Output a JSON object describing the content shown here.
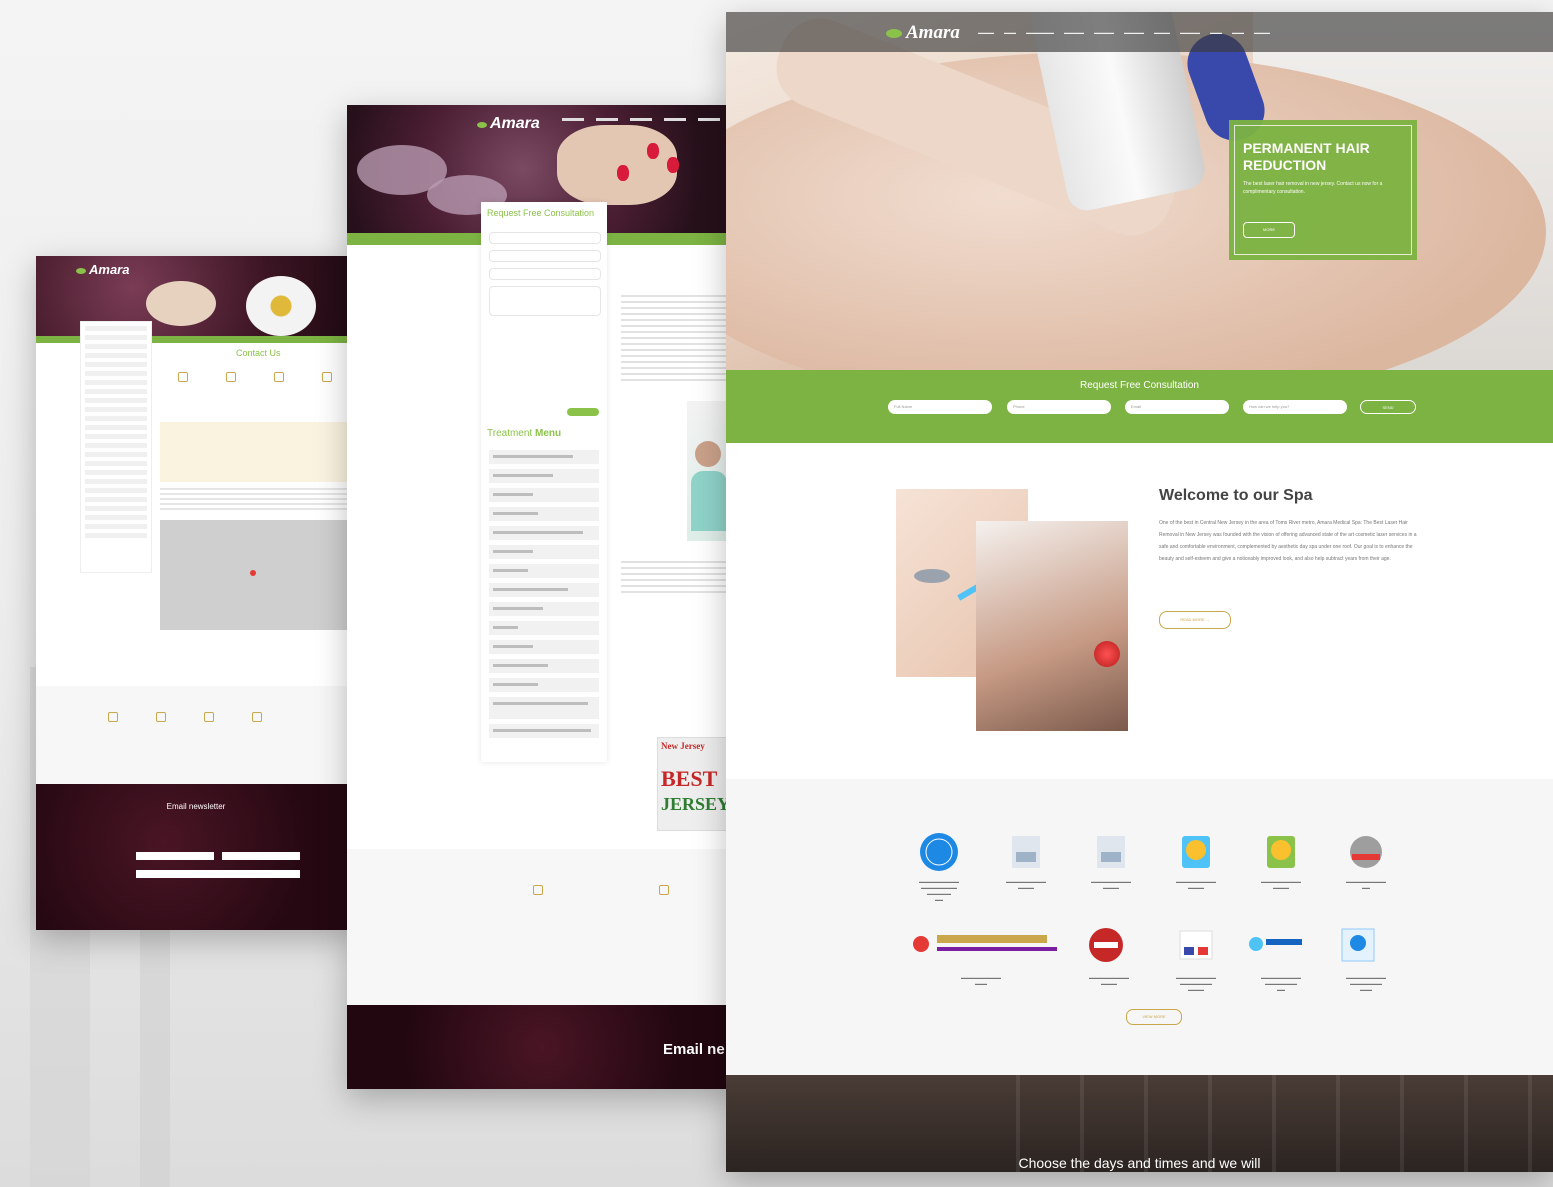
{
  "shot1": {
    "logo": "Amara",
    "contact_title": "Contact Us",
    "newsletter_title": "Email newsletter"
  },
  "shot2": {
    "logo": "Amara",
    "form_title": "Request Free Consultation",
    "treatment_menu_prefix": "Treatment",
    "treatment_menu_suffix": "Menu",
    "magazine_line1": "New Jersey",
    "magazine_line2": "BEST",
    "magazine_line3": "JERSEY",
    "newsletter_title": "Email ne"
  },
  "shot3": {
    "logo": "Amara",
    "promo": {
      "title": "PERMANENT HAIR REDUCTION",
      "text": "The best laser hair removal in new jersey. Contact us now for a complimentary consultation.",
      "button": "MORE"
    },
    "consult_title": "Request Free Consultation",
    "consult_fields": [
      "Full Name",
      "Phone",
      "Email",
      "How can we help you?"
    ],
    "consult_submit": "SEND",
    "welcome_title": "Welcome to our Spa",
    "welcome_text": "One of the best in Central New Jersey in the area of Toms River metro, Amara Medical Spa: The Best Laser Hair Removal in New Jersey was founded with the vision of offering advanced state of the art cosmetic laser services in a safe and comfortable environment, complemented by aesthetic day spa under one roof. Our goal is to enhance the beauty and self-esteem and give a noticeably improved look, and also help subtract years from their age.",
    "read_more": "READ MORE →",
    "view_more": "VIEW MORE",
    "schedule_title": "Choose the days and times and we will"
  },
  "colors": {
    "brand_green": "#7cb342",
    "accent_gold": "#c9a74a",
    "burgundy": "#3b1422"
  }
}
